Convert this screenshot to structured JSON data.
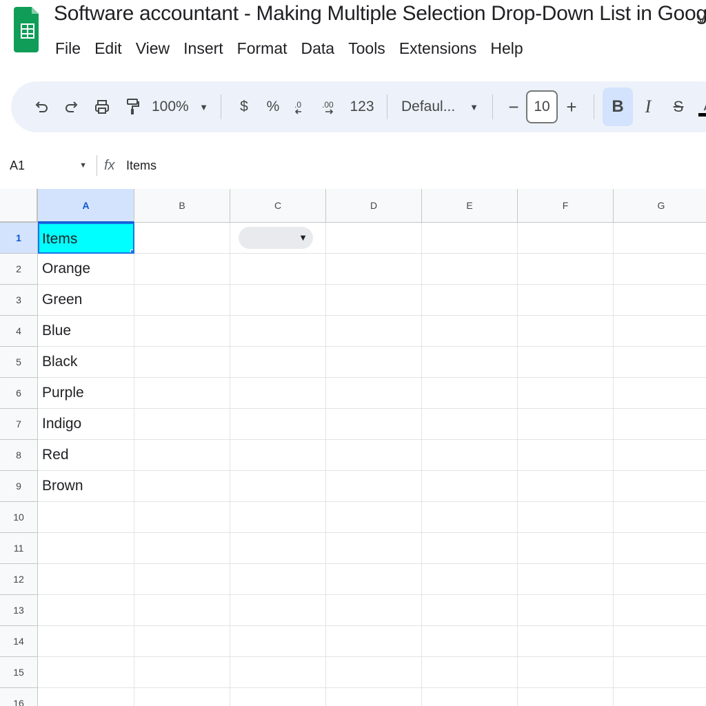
{
  "app": {
    "title": "Software accountant - Making Multiple Selection Drop-Down List in Google Sheets",
    "title_trunc": "v",
    "brand_color": "#0f9d58"
  },
  "menu": [
    "File",
    "Edit",
    "View",
    "Insert",
    "Format",
    "Data",
    "Tools",
    "Extensions",
    "Help"
  ],
  "toolbar": {
    "undo_icon": "undo-icon",
    "redo_icon": "redo-icon",
    "print_icon": "print-icon",
    "paint_icon": "paint-format-icon",
    "zoom": "100%",
    "currency": "$",
    "percent": "%",
    "decimal_decrease": ".0",
    "decimal_increase": ".00",
    "number_format": "123",
    "font": "Defaul...",
    "font_size_minus": "−",
    "font_size": "10",
    "font_size_plus": "+",
    "bold": "B",
    "italic": "I",
    "strikethrough": "S",
    "text_color": "A"
  },
  "formula_bar": {
    "cell_ref": "A1",
    "fx": "fx",
    "value": "Items"
  },
  "columns": [
    "A",
    "B",
    "C",
    "D",
    "E",
    "F",
    "G"
  ],
  "active_column": "A",
  "active_row": "1",
  "rows": [
    "1",
    "2",
    "3",
    "4",
    "5",
    "6",
    "7",
    "8",
    "9",
    "10",
    "11",
    "12",
    "13",
    "14",
    "15",
    "16"
  ],
  "column_a_values": [
    "Items",
    "Orange",
    "Green",
    "Blue",
    "Black",
    "Purple",
    "Indigo",
    "Red",
    "Brown"
  ],
  "colors": {
    "selected_cell_fill": "#00ffff",
    "selection_border": "#1a73e8",
    "toolbar_bg": "#edf2fa"
  }
}
